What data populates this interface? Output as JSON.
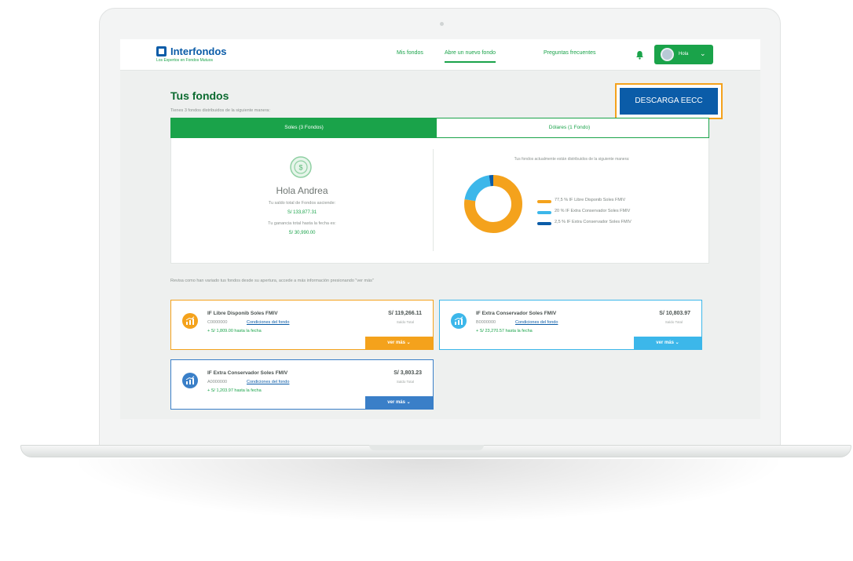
{
  "brand": {
    "name": "Interfondos",
    "tagline": "Los Expertos en Fondos Mutuos",
    "primary_color": "#0b5ca8",
    "green_color": "#1aa34a",
    "orange_color": "#f4a21c",
    "light_blue_color": "#3cb7ea"
  },
  "nav": {
    "links": [
      {
        "label": "Mis fondos"
      },
      {
        "label": "Abre un nuevo fondo"
      },
      {
        "label": "Preguntas frecuentes"
      }
    ],
    "active_index": 1,
    "user_name": "Hola"
  },
  "header": {
    "title": "Tus fondos",
    "subtitle": "Tienes 3 fondos distribuidos de la siguiente manera:",
    "download_label": "DESCARGA EECC"
  },
  "tabs": [
    {
      "label": "Soles (3 Fondos)"
    },
    {
      "label": "Dólares (1 Fondo)"
    }
  ],
  "summary": {
    "greeting": "Hola Andrea",
    "balance_text": "Tu saldo total de Fondos asciende:",
    "balance_value": "S/ 133,877.31",
    "gain_text": "Tu ganancia total hasta la fecha es:",
    "gain_value": "S/ 30,990.00"
  },
  "distribution": {
    "caption": "Tus fondos actualmente están distribuidos de la siguiente manera:",
    "items": [
      {
        "label": "77,5 % IF Libre Disponib Soles FMIV",
        "percent": 77.5,
        "color": "#f4a21c"
      },
      {
        "label": "20 % IF Extra Conservador Soles FMIV",
        "percent": 20,
        "color": "#3cb7ea"
      },
      {
        "label": "2,5 % IF Extra Conservador Soles FMIV",
        "percent": 2.5,
        "color": "#0b5ca8"
      }
    ]
  },
  "hint": "Revisa como han variado tus fondos desde su apertura, accede a más información presionando \"ver más\"",
  "funds": [
    {
      "name": "IF Libre Disponib Soles FMIV",
      "code": "C0000000",
      "conditions": "Condiciones del fondo",
      "gain": "+ S/ 1,809.00 hasta la fecha",
      "amount": "S/ 119,266.11",
      "amount_label": "Saldo Total",
      "more": "ver más",
      "accent": "#f4a21c"
    },
    {
      "name": "IF Extra Conservador Soles FMIV",
      "code": "B0000000",
      "conditions": "Condiciones del fondo",
      "gain": "+ S/ 23,270.57 hasta la fecha",
      "amount": "S/ 10,803.97",
      "amount_label": "Saldo Total",
      "more": "ver más",
      "accent": "#3cb7ea"
    },
    {
      "name": "IF Extra Conservador Soles FMIV",
      "code": "A0000000",
      "conditions": "Condiciones del fondo",
      "gain": "+ S/ 1,203.97 hasta la fecha",
      "amount": "S/ 3,803.23",
      "amount_label": "Saldo Total",
      "more": "ver más",
      "accent": "#3a7fc8"
    }
  ]
}
